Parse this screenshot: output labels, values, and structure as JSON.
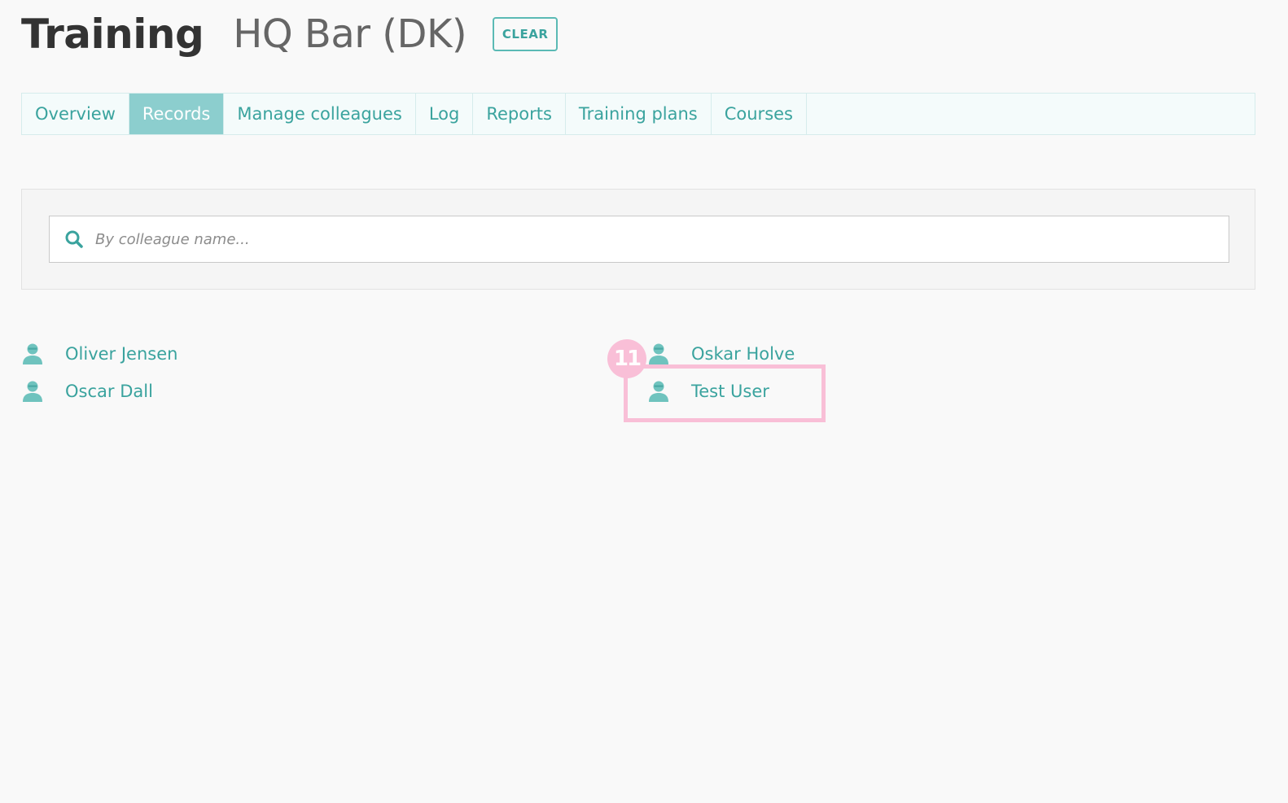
{
  "header": {
    "title": "Training",
    "location": "HQ Bar (DK)",
    "clear_label": "CLEAR"
  },
  "tabs": [
    {
      "label": "Overview",
      "active": false
    },
    {
      "label": "Records",
      "active": true
    },
    {
      "label": "Manage colleagues",
      "active": false
    },
    {
      "label": "Log",
      "active": false
    },
    {
      "label": "Reports",
      "active": false
    },
    {
      "label": "Training plans",
      "active": false
    },
    {
      "label": "Courses",
      "active": false
    }
  ],
  "search": {
    "placeholder": "By colleague name...",
    "value": ""
  },
  "colleagues": [
    {
      "name": "Oliver Jensen",
      "icon": "person-icon"
    },
    {
      "name": "Oscar Dall",
      "icon": "person-icon"
    },
    {
      "name": "Oskar Holve",
      "icon": "person-icon"
    },
    {
      "name": "Test User",
      "icon": "person-icon"
    }
  ],
  "annotation": {
    "step": "11"
  },
  "colors": {
    "accent": "#3aa39e",
    "active_tab": "#8ccece",
    "highlight": "#f9bfd7"
  }
}
